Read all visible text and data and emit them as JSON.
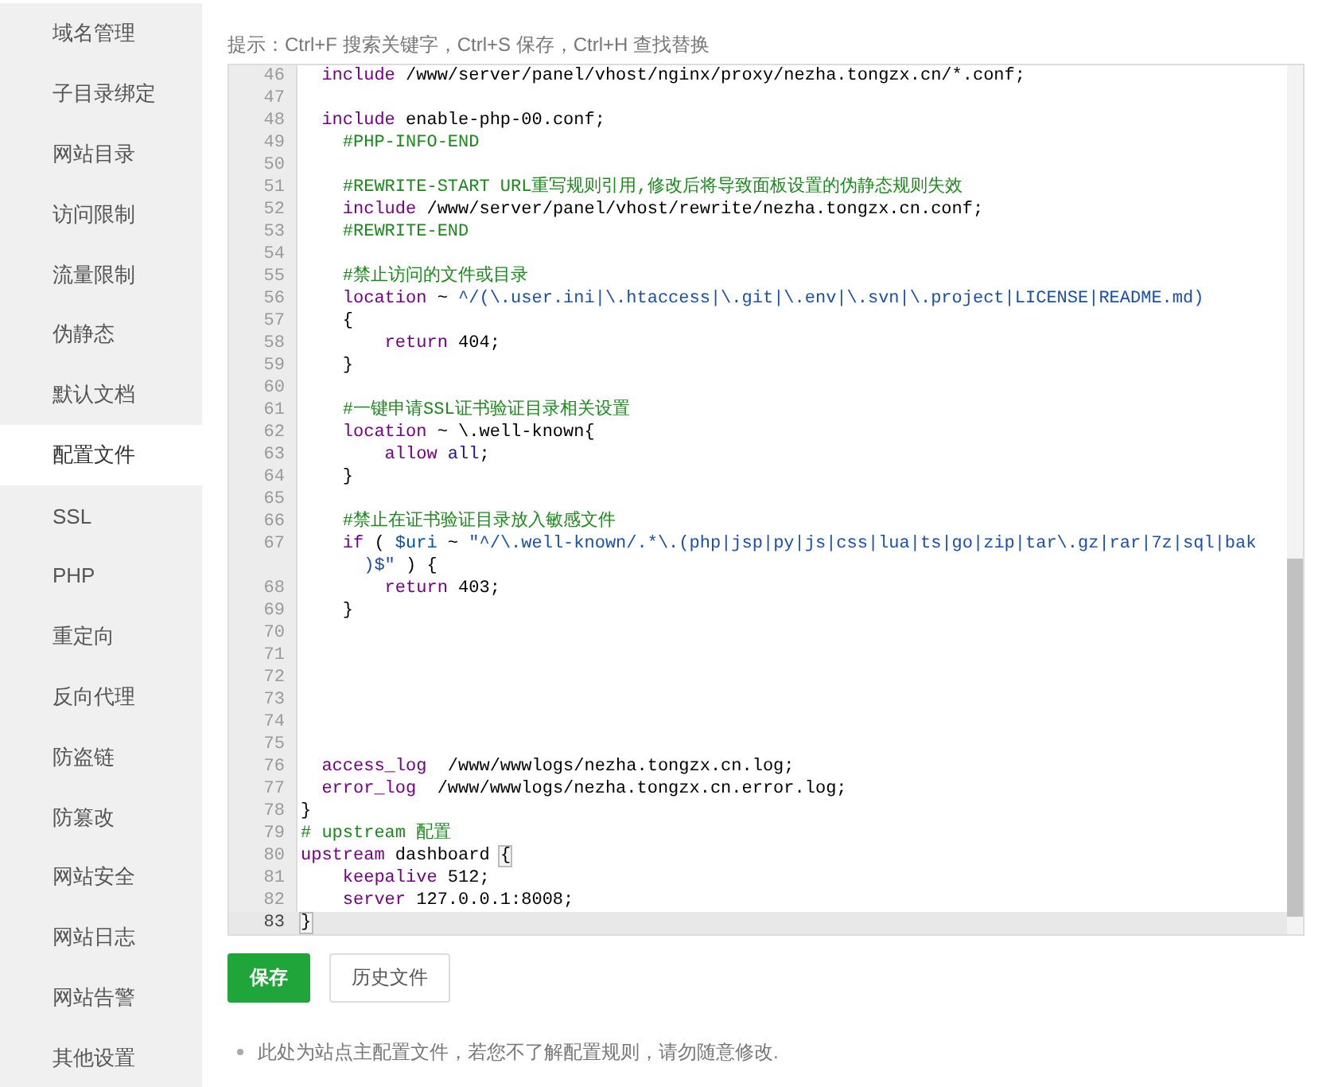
{
  "sidebar": {
    "items": [
      {
        "label": "域名管理",
        "selected": false
      },
      {
        "label": "子目录绑定",
        "selected": false
      },
      {
        "label": "网站目录",
        "selected": false
      },
      {
        "label": "访问限制",
        "selected": false
      },
      {
        "label": "流量限制",
        "selected": false
      },
      {
        "label": "伪静态",
        "selected": false
      },
      {
        "label": "默认文档",
        "selected": false
      },
      {
        "label": "配置文件",
        "selected": true
      },
      {
        "label": "SSL",
        "selected": false
      },
      {
        "label": "PHP",
        "selected": false
      },
      {
        "label": "重定向",
        "selected": false
      },
      {
        "label": "反向代理",
        "selected": false
      },
      {
        "label": "防盗链",
        "selected": false
      },
      {
        "label": "防篡改",
        "selected": false
      },
      {
        "label": "网站安全",
        "selected": false
      },
      {
        "label": "网站日志",
        "selected": false
      },
      {
        "label": "网站告警",
        "selected": false
      },
      {
        "label": "其他设置",
        "selected": false
      }
    ]
  },
  "hint": "提示：Ctrl+F 搜索关键字，Ctrl+S 保存，Ctrl+H 查找替换",
  "editor": {
    "lines": [
      {
        "number": "46",
        "active": false,
        "tokens": [
          {
            "kind": "keyword",
            "text": "  include"
          },
          {
            "kind": "plain",
            "text": " /www/server/panel/vhost/nginx/proxy/nezha.tongzx.cn/*.conf;"
          }
        ]
      },
      {
        "number": "47",
        "active": false
      },
      {
        "number": "48",
        "active": false,
        "tokens": [
          {
            "kind": "keyword",
            "text": "  include"
          },
          {
            "kind": "plain",
            "text": " enable-php-00.conf;"
          }
        ]
      },
      {
        "number": "49",
        "active": false,
        "tokens": [
          {
            "kind": "comment",
            "text": "    #PHP-INFO-END"
          }
        ]
      },
      {
        "number": "50",
        "active": false
      },
      {
        "number": "51",
        "active": false,
        "tokens": [
          {
            "kind": "comment",
            "text": "    #REWRITE-START URL重写规则引用,修改后将导致面板设置的伪静态规则失效"
          }
        ]
      },
      {
        "number": "52",
        "active": false,
        "tokens": [
          {
            "kind": "keyword",
            "text": "    include"
          },
          {
            "kind": "plain",
            "text": " /www/server/panel/vhost/rewrite/nezha.tongzx.cn.conf;"
          }
        ]
      },
      {
        "number": "53",
        "active": false,
        "tokens": [
          {
            "kind": "comment",
            "text": "    #REWRITE-END"
          }
        ]
      },
      {
        "number": "54",
        "active": false
      },
      {
        "number": "55",
        "active": false,
        "tokens": [
          {
            "kind": "comment",
            "text": "    #禁止访问的文件或目录"
          }
        ]
      },
      {
        "number": "56",
        "active": false,
        "tokens": [
          {
            "kind": "keyword",
            "text": "    location"
          },
          {
            "kind": "plain",
            "text": " ~ "
          },
          {
            "kind": "regex",
            "text": "^/(\\.user.ini|\\.htaccess|\\.git|\\.env|\\.svn|\\.project|LICENSE|README.md)"
          }
        ]
      },
      {
        "number": "57",
        "active": false,
        "tokens": [
          {
            "kind": "plain",
            "text": "    {"
          }
        ]
      },
      {
        "number": "58",
        "active": false,
        "tokens": [
          {
            "kind": "keyword",
            "text": "        return"
          },
          {
            "kind": "plain",
            "text": " 404;"
          }
        ]
      },
      {
        "number": "59",
        "active": false,
        "tokens": [
          {
            "kind": "plain",
            "text": "    }"
          }
        ]
      },
      {
        "number": "60",
        "active": false
      },
      {
        "number": "61",
        "active": false,
        "tokens": [
          {
            "kind": "comment",
            "text": "    #一键申请SSL证书验证目录相关设置"
          }
        ]
      },
      {
        "number": "62",
        "active": false,
        "tokens": [
          {
            "kind": "keyword",
            "text": "    location"
          },
          {
            "kind": "plain",
            "text": " ~ \\.well-known{"
          }
        ]
      },
      {
        "number": "63",
        "active": false,
        "tokens": [
          {
            "kind": "keyword",
            "text": "        allow"
          },
          {
            "kind": "atom",
            "text": " all"
          },
          {
            "kind": "plain",
            "text": ";"
          }
        ]
      },
      {
        "number": "64",
        "active": false,
        "tokens": [
          {
            "kind": "plain",
            "text": "    }"
          }
        ]
      },
      {
        "number": "65",
        "active": false
      },
      {
        "number": "66",
        "active": false,
        "tokens": [
          {
            "kind": "comment",
            "text": "    #禁止在证书验证目录放入敏感文件"
          }
        ]
      },
      {
        "number": "67",
        "active": false,
        "tokens": [
          {
            "kind": "keyword",
            "text": "    if"
          },
          {
            "kind": "plain",
            "text": " ( "
          },
          {
            "kind": "variable",
            "text": "$uri"
          },
          {
            "kind": "plain",
            "text": " ~ "
          },
          {
            "kind": "regex",
            "text": "\"^/\\.well-known/.*\\.(php|jsp|py|js|css|lua|ts|go|zip|tar\\.gz|rar|7z|sql|bak"
          }
        ],
        "continued": [
          {
            "kind": "regex",
            "text": "      )$\""
          },
          {
            "kind": "plain",
            "text": " ) {"
          }
        ]
      },
      {
        "number": "68",
        "active": false,
        "tokens": [
          {
            "kind": "keyword",
            "text": "        return"
          },
          {
            "kind": "plain",
            "text": " 403;"
          }
        ]
      },
      {
        "number": "69",
        "active": false,
        "tokens": [
          {
            "kind": "plain",
            "text": "    }"
          }
        ]
      },
      {
        "number": "70",
        "active": false
      },
      {
        "number": "71",
        "active": false
      },
      {
        "number": "72",
        "active": false
      },
      {
        "number": "73",
        "active": false
      },
      {
        "number": "74",
        "active": false
      },
      {
        "number": "75",
        "active": false
      },
      {
        "number": "76",
        "active": false,
        "tokens": [
          {
            "kind": "keyword",
            "text": "  access_log"
          },
          {
            "kind": "plain",
            "text": "  /www/wwwlogs/nezha.tongzx.cn.log;"
          }
        ]
      },
      {
        "number": "77",
        "active": false,
        "tokens": [
          {
            "kind": "keyword",
            "text": "  error_log"
          },
          {
            "kind": "plain",
            "text": "  /www/wwwlogs/nezha.tongzx.cn.error.log;"
          }
        ]
      },
      {
        "number": "78",
        "active": false,
        "tokens": [
          {
            "kind": "plain",
            "text": "}"
          }
        ]
      },
      {
        "number": "79",
        "active": false,
        "tokens": [
          {
            "kind": "comment",
            "text": "# upstream 配置"
          }
        ]
      },
      {
        "number": "80",
        "active": false,
        "tokens": [
          {
            "kind": "keyword",
            "text": "upstream"
          },
          {
            "kind": "plain",
            "text": " dashboard "
          },
          {
            "kind": "bracket",
            "text": "{"
          }
        ]
      },
      {
        "number": "81",
        "active": false,
        "tokens": [
          {
            "kind": "keyword",
            "text": "    keepalive"
          },
          {
            "kind": "plain",
            "text": " 512;"
          }
        ]
      },
      {
        "number": "82",
        "active": false,
        "tokens": [
          {
            "kind": "keyword",
            "text": "    server"
          },
          {
            "kind": "plain",
            "text": " 127.0.0.1:8008;"
          }
        ]
      },
      {
        "number": "83",
        "active": true,
        "tokens": [
          {
            "kind": "bracket",
            "text": "}"
          }
        ]
      }
    ]
  },
  "buttons": [
    {
      "label": "保存",
      "kind": "primary"
    },
    {
      "label": "历史文件",
      "kind": "default"
    }
  ],
  "notes": [
    "此处为站点主配置文件，若您不了解配置规则，请勿随意修改."
  ]
}
